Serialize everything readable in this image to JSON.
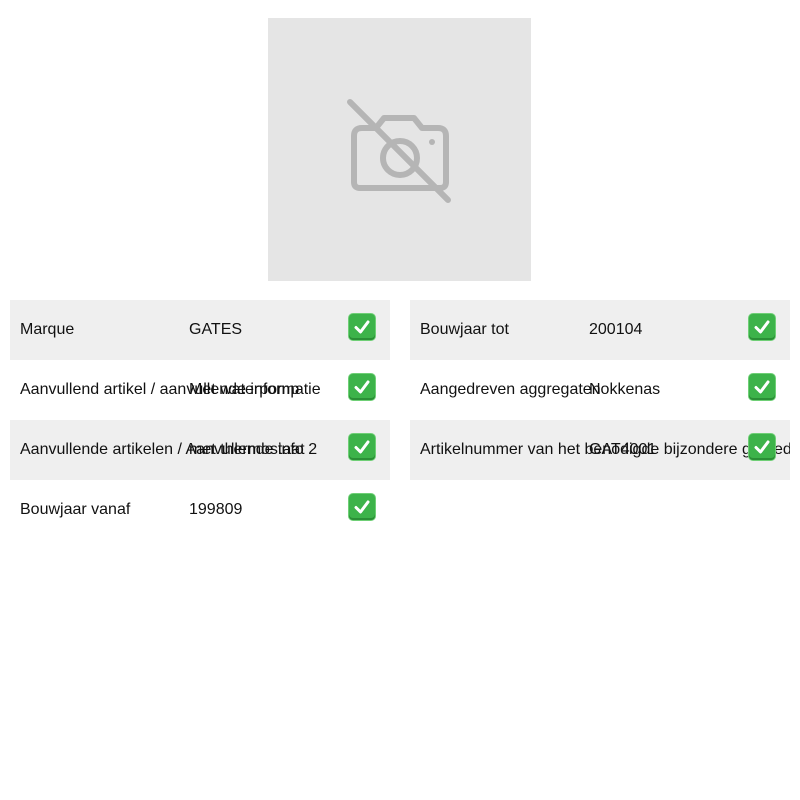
{
  "product_image": {
    "icon": "no-photo-icon"
  },
  "attributes": {
    "left": [
      {
        "label": "Marque",
        "value": "GATES",
        "status": "check-icon"
      },
      {
        "label": "Aanvullend artikel / aanvullende informatie",
        "value": "Met waterpomp",
        "status": "check-icon"
      },
      {
        "label": "Aanvullende artikelen / Aanvullende info 2",
        "value": "met thermostaat",
        "status": "check-icon"
      },
      {
        "label": "Bouwjaar vanaf",
        "value": "199809",
        "status": "check-icon"
      }
    ],
    "right": [
      {
        "label": "Bouwjaar tot",
        "value": "200104",
        "status": "check-icon"
      },
      {
        "label": "Aangedreven aggregaten",
        "value": "Nokkenas",
        "status": "check-icon"
      },
      {
        "label": "Artikelnummer van het benodigde bijzondere gereedschap",
        "value": "GAT4001",
        "status": "check-icon"
      }
    ]
  },
  "colors": {
    "row_shade": "#efefef",
    "placeholder_bg": "#e5e5e5",
    "placeholder_icon": "#b5b5b5",
    "check_green": "#3db34a"
  }
}
